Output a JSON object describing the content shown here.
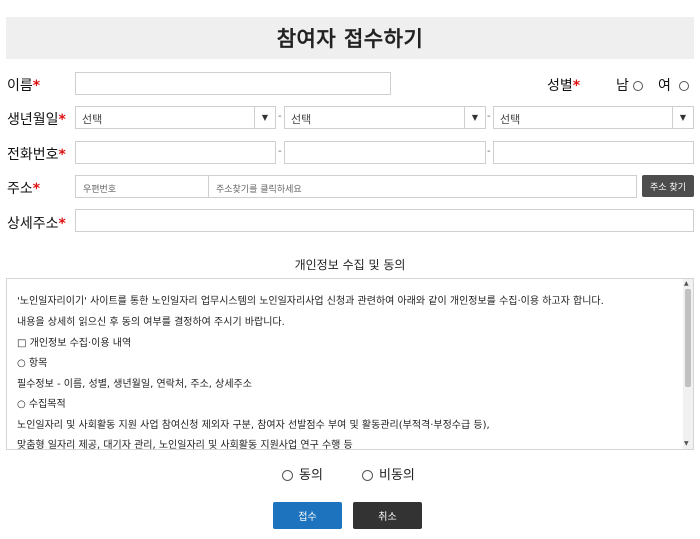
{
  "page": {
    "title": "참여자 접수하기"
  },
  "form": {
    "name_label": "이름",
    "gender_label": "성별",
    "gender_male": "남",
    "gender_female": "여",
    "birth_label": "생년월일",
    "birth_year_value": "선택",
    "birth_month_value": "선택",
    "birth_day_value": "선택",
    "phone_label": "전화번호",
    "address_label": "주소",
    "zipcode_placeholder": "우편번호",
    "address_placeholder": "주소찾기를 클릭하세요",
    "address_search_button": "주소 찾기",
    "address_detail_label": "상세주소",
    "required_mark": "*",
    "dash": "-"
  },
  "privacy": {
    "section_title": "개인정보 수집 및 동의",
    "lines": [
      "'노인일자리이기' 사이트를 통한 노인일자리 업무시스템의 노인일자리사업 신청과 관련하여 아래와 같이 개인정보를 수집·이용 하고자 합니다.",
      "내용을 상세히 읽으신 후 동의 여부를 결정하여 주시기 바랍니다.",
      "□ 개인정보 수집·이용 내역",
      "○ 항목",
      "필수정보 - 이름, 성별, 생년월일, 연락처, 주소, 상세주소",
      "○ 수집목적",
      "노인일자리 및 사회활동 지원 사업 참여신청 제외자 구분, 참여자 선발점수 부여 및 활동관리(부적격·부정수급 등),",
      "맞춤형 일자리 제공, 대기자 관리, 노인일자리 및 사회활동 지원사업 연구 수행 등"
    ],
    "agree_label": "동의",
    "disagree_label": "비동의"
  },
  "actions": {
    "submit_label": "접수",
    "cancel_label": "취소"
  },
  "colors": {
    "required": "#dd1111",
    "primary": "#1e73be",
    "dark": "#333333",
    "title_bg": "#efefef"
  }
}
